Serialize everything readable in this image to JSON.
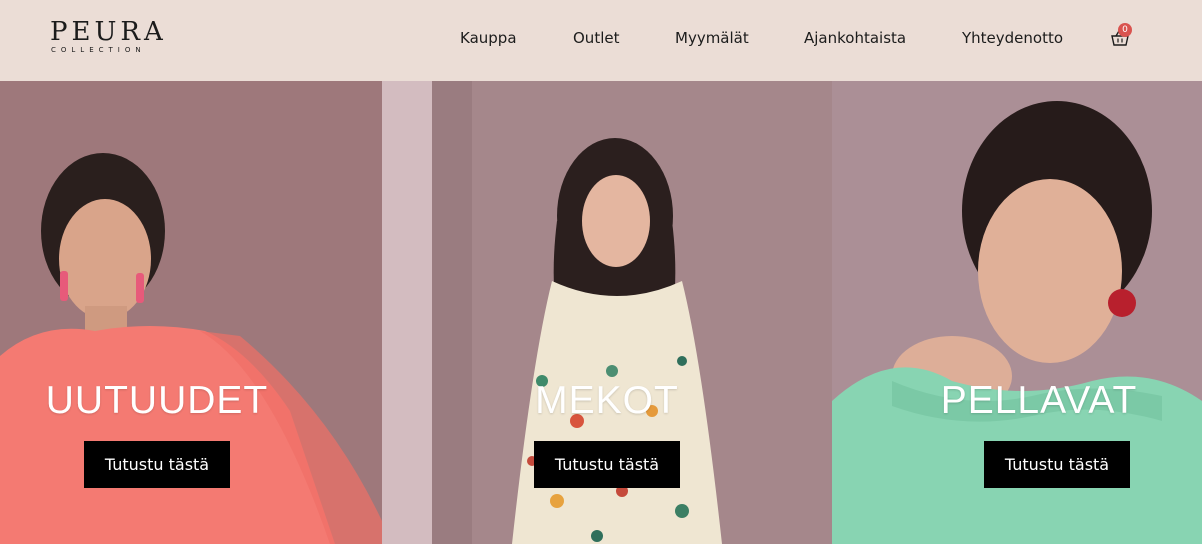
{
  "brand": {
    "name": "PEURA",
    "sub": "COLLECTION"
  },
  "nav": [
    "Kauppa",
    "Outlet",
    "Myymälät",
    "Ajankohtaista",
    "Yhteydenotto"
  ],
  "cart": {
    "count": "0",
    "icon": "basket-icon"
  },
  "panels": [
    {
      "title": "UUTUUDET",
      "button": "Tutustu tästä"
    },
    {
      "title": "MEKOT",
      "button": "Tutustu tästä"
    },
    {
      "title": "PELLAVAT",
      "button": "Tutustu tästä"
    }
  ]
}
